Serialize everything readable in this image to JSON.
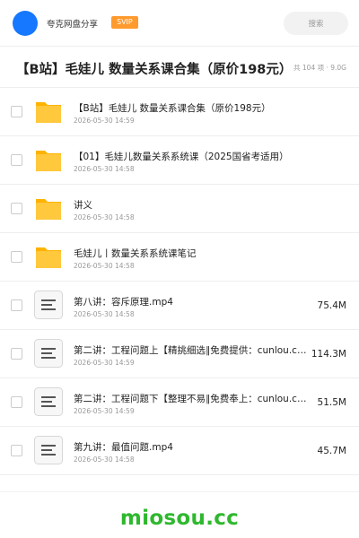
{
  "header": {
    "app_name": "夸克网盘分享",
    "badge": "SVIP",
    "search_label": "搜索"
  },
  "folder": {
    "title": "【B站】毛娃儿 数量关系课合集（原价198元）",
    "meta": "共 104 项 · 9.0G"
  },
  "items": [
    {
      "type": "folder",
      "icon": "folder-icon",
      "name": "【B站】毛娃儿 数量关系课合集（原价198元）",
      "date": "2026-05-30 14:59",
      "size": ""
    },
    {
      "type": "folder",
      "icon": "folder-icon",
      "name": "【01】毛娃儿数量关系系统课（2025国省考适用）",
      "date": "2026-05-30 14:58",
      "size": ""
    },
    {
      "type": "folder",
      "icon": "folder-icon",
      "name": "讲义",
      "date": "2026-05-30 14:58",
      "size": ""
    },
    {
      "type": "folder",
      "icon": "folder-icon",
      "name": "毛娃儿丨数量关系系统课笔记",
      "date": "2026-05-30 14:58",
      "size": ""
    },
    {
      "type": "file",
      "icon": "file-icon",
      "name": "第八讲：容斥原理.mp4",
      "date": "2026-05-30 14:58",
      "size": "75.4M"
    },
    {
      "type": "file",
      "icon": "file-icon",
      "name": "第二讲：工程问题上【精挑细选∥免费提供：cunlou.com",
      "date": "2026-05-30 14:59",
      "size": "114.3M"
    },
    {
      "type": "file",
      "icon": "file-icon",
      "name": "第二讲：工程问题下【整理不易∥免费奉上：cunlou.com",
      "date": "2026-05-30 14:59",
      "size": "51.5M"
    },
    {
      "type": "file",
      "icon": "file-icon",
      "name": "第九讲：最值问题.mp4",
      "date": "2026-05-30 14:58",
      "size": "45.7M"
    }
  ],
  "footer": {
    "brand": "miosou.cc"
  },
  "colors": {
    "accent": "#1677ff",
    "badge": "#ff9a2e",
    "folder": "#ffc107",
    "brand": "#2eb82e"
  }
}
